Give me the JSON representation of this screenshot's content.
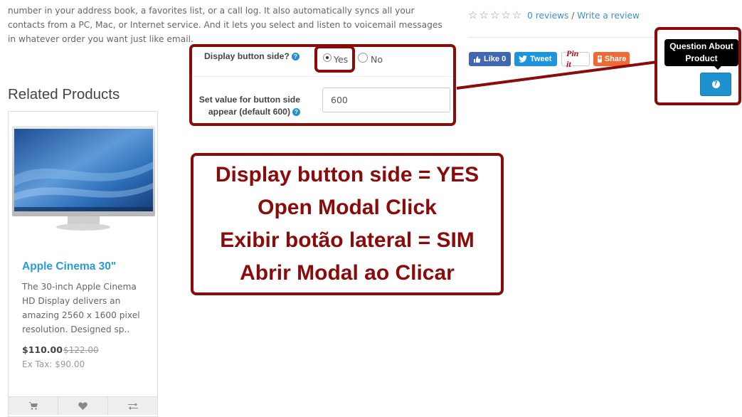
{
  "description": {
    "text": "number in your address book, a favorites list, or a call log. It also automatically syncs all your contacts from a PC, Mac, or Internet service. And it lets you select and listen to voicemail messages in whatever order you want just like email."
  },
  "rating": {
    "stars": "☆☆☆☆☆",
    "reviews_link": "0 reviews",
    "separator": " / ",
    "write_link": "Write a review"
  },
  "share": {
    "facebook": "Like 0",
    "twitter": "Tweet",
    "pinterest": "Pin it",
    "share": "Share"
  },
  "related": {
    "heading": "Related Products",
    "product": {
      "name": "Apple Cinema 30\"",
      "description": "The 30-inch Apple Cinema HD Display delivers an amazing 2560 x 1600 pixel resolution. Designed sp..",
      "price": "$110.00",
      "old_price": "$122.00",
      "ex_tax": "Ex Tax: $90.00"
    }
  },
  "settings": {
    "display_side_label": "Display button side?",
    "yes_label": "Yes",
    "no_label": "No",
    "selected": "Yes",
    "value_label": "Set value for button side appear (default 600)",
    "value": "600"
  },
  "widget": {
    "tooltip": "Question About Product"
  },
  "callout": {
    "lines": [
      "Display button side = YES",
      "Open Modal Click",
      "Exibir botão lateral = SIM",
      "Abrir Modal ao Clicar"
    ]
  },
  "colors": {
    "annotation": "#8b0a0a",
    "link": "#2a9bd4",
    "button": "#1e91cf"
  }
}
